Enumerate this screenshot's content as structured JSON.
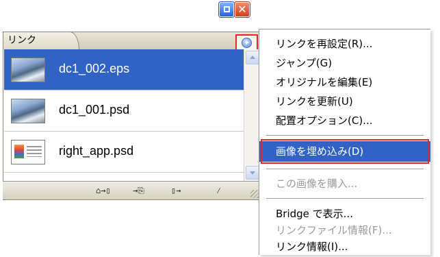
{
  "palette": {
    "tab_label": "リンク",
    "close_glyph": "✕",
    "links": [
      {
        "name": "dc1_002.eps",
        "thumbnail": "photo",
        "selected": true
      },
      {
        "name": "dc1_001.psd",
        "thumbnail": "photo",
        "selected": false
      },
      {
        "name": "right_app.psd",
        "thumbnail": "document",
        "selected": false
      }
    ],
    "footer_buttons": [
      "⌂→▯",
      "→⎘",
      "▯→",
      "⁄"
    ]
  },
  "context_menu": {
    "items": [
      {
        "label": "リンクを再設定(R)...",
        "enabled": true
      },
      {
        "label": "ジャンプ(G)",
        "enabled": true
      },
      {
        "label": "オリジナルを編集(E)",
        "enabled": true
      },
      {
        "label": "リンクを更新(U)",
        "enabled": true
      },
      {
        "label": "配置オプション(C)...",
        "enabled": true
      },
      {
        "label": "画像を埋め込み(D)",
        "enabled": true,
        "highlighted": true
      },
      {
        "label": "この画像を購入...",
        "enabled": false
      },
      {
        "label": "Bridge で表示...",
        "enabled": true
      },
      {
        "label": "リンクファイル情報(F)...",
        "enabled": false
      },
      {
        "label": "リンク情報(I)...",
        "enabled": true
      }
    ]
  },
  "colors": {
    "selection": "#3163c5",
    "highlight_border": "#e8242b"
  }
}
